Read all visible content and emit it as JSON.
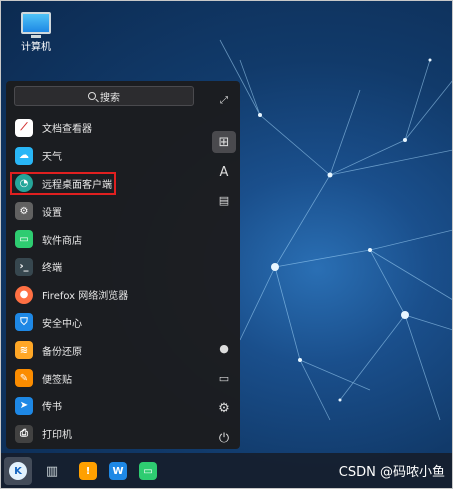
{
  "desktop": {
    "computer_label": "计算机"
  },
  "menu": {
    "search_label": "搜索",
    "apps": [
      {
        "label": "文档查看器",
        "icon": "document-viewer-icon",
        "color": "#d32f2f"
      },
      {
        "label": "天气",
        "icon": "weather-icon",
        "color": "#29b6f6"
      },
      {
        "label": "远程桌面客户端",
        "icon": "remote-desktop-icon",
        "color": "#26a69a"
      },
      {
        "label": "设置",
        "icon": "settings-icon",
        "color": "#616161"
      },
      {
        "label": "软件商店",
        "icon": "app-store-icon",
        "color": "#2ecc71"
      },
      {
        "label": "终端",
        "icon": "terminal-icon",
        "color": "#37474f"
      },
      {
        "label": "Firefox 网络浏览器",
        "icon": "firefox-icon",
        "color": "#ff7043"
      },
      {
        "label": "安全中心",
        "icon": "security-center-icon",
        "color": "#1e88e5"
      },
      {
        "label": "备份还原",
        "icon": "backup-restore-icon",
        "color": "#ffa726"
      },
      {
        "label": "便签贴",
        "icon": "sticky-notes-icon",
        "color": "#fb8c00"
      },
      {
        "label": "传书",
        "icon": "file-transfer-icon",
        "color": "#1e88e5"
      },
      {
        "label": "打印机",
        "icon": "printer-icon",
        "color": "#424242"
      }
    ],
    "right_icons": [
      "expand-icon",
      "grid-view-icon",
      "letter-sort-icon",
      "category-icon",
      "user-icon",
      "monitor-icon",
      "settings-icon",
      "power-icon"
    ]
  },
  "taskbar": {
    "watermark": "CSDN @码哝小鱼",
    "items": [
      "start-menu-icon",
      "multitask-view-icon",
      "file-manager-icon",
      "kylin-manager-icon",
      "app-store-icon"
    ]
  },
  "colors": {
    "highlight_border": "#e02020"
  }
}
